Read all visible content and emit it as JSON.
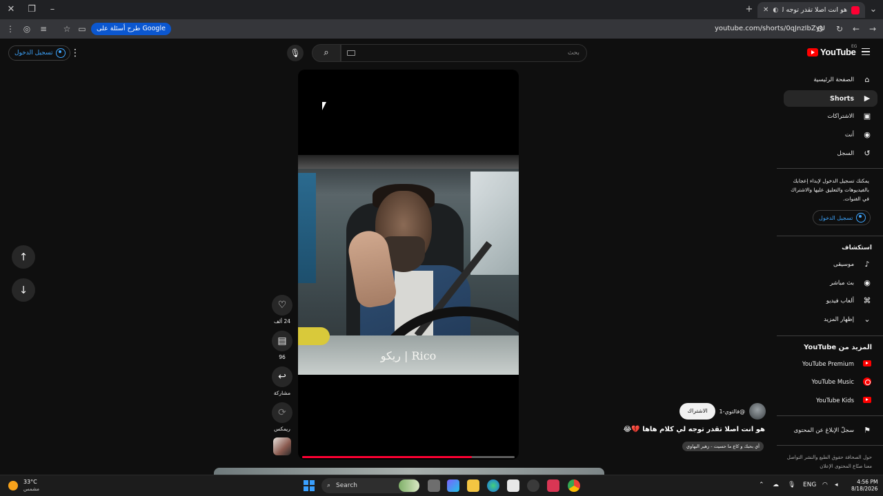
{
  "browser": {
    "tab_title": "هو انت اصلا تقدر توجه لي ك",
    "url": "youtube.com/shorts/0qJnzIbZyU",
    "google_chip_label": "طرح أسئلة على Google"
  },
  "masthead": {
    "signin_label": "تسجيل الدخول",
    "search_placeholder": "بحث",
    "logo_text": "YouTube",
    "logo_country": "EG"
  },
  "sidebar": {
    "items": [
      {
        "label": "الصفحة الرئيسية",
        "icon": "home-icon"
      },
      {
        "label": "Shorts",
        "icon": "shorts-icon",
        "active": true
      },
      {
        "label": "الاشتراكات",
        "icon": "subscriptions-icon"
      },
      {
        "label": "أنت",
        "icon": "user-icon"
      },
      {
        "label": "السجل",
        "icon": "history-icon"
      }
    ],
    "promo_text": "يمكنك تسجيل الدخول لإبداء إعجابك بالفيديوهات والتعليق عليها والاشتراك في القنوات.",
    "signin_label": "تسجيل الدخول",
    "explore_heading": "استكشاف",
    "explore": [
      {
        "label": "موسيقى",
        "icon": "music-icon"
      },
      {
        "label": "بث مباشر",
        "icon": "live-icon"
      },
      {
        "label": "ألعاب فيديو",
        "icon": "gaming-icon"
      },
      {
        "label": "إظهار المزيد",
        "icon": "chevron-down-icon"
      }
    ],
    "more_heading": "المزيد من YouTube",
    "more": [
      {
        "label": "YouTube Premium",
        "icon": "youtube-premium-icon"
      },
      {
        "label": "YouTube Music",
        "icon": "youtube-music-icon"
      },
      {
        "label": "YouTube Kids",
        "icon": "youtube-kids-icon"
      }
    ],
    "report_label": "سجلّ الإبلاغ عن المحتوى",
    "footer": "حول الصحافة حقوق الطبع والنشر التواصل معنا صنّاع المحتوى الإعلان"
  },
  "short": {
    "caption": "ريكو | Rico",
    "progress_fraction": 0.8,
    "actions": {
      "like_count": "24 ألف",
      "comment_count": "96",
      "share_label": "مشاركة",
      "remix_label": "ريمكس"
    },
    "channel_handle": "@فالتوي-1",
    "subscribe_label": "الاشتراك",
    "title": "هو انت اصلا تقدر توجه لي كلام هاها 💔😂",
    "sound": "أي بحبك و كاع ما حسيت - زهير البهاوي"
  },
  "taskbar": {
    "temperature": "33°C",
    "condition": "مشمس",
    "search_label": "Search",
    "language": "ENG",
    "time": "4:56 PM",
    "date": "8/18/2026"
  },
  "colors": {
    "accent_red": "#ff0033",
    "link_blue": "#3ea6ff",
    "background": "#0f0f0f"
  }
}
